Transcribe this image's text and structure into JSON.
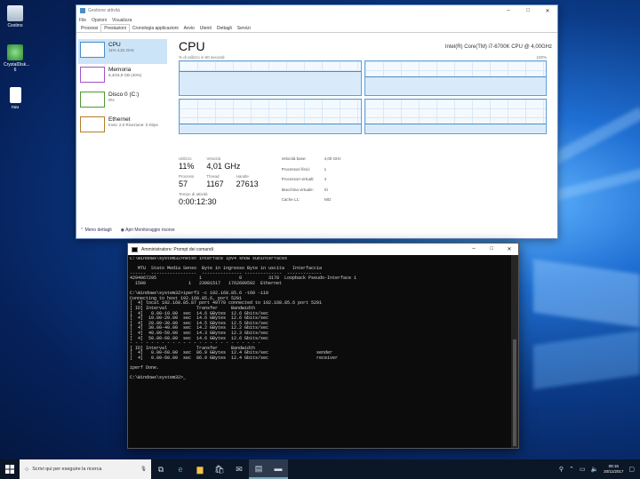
{
  "desktop": {
    "icons": [
      {
        "label": "Cestino"
      },
      {
        "label": "CrystalDisk...\n6"
      },
      {
        "label": "nuu"
      }
    ]
  },
  "taskmgr": {
    "title": "Gestione attività",
    "menu": [
      "File",
      "Opzioni",
      "Visualizza"
    ],
    "tabs": [
      "Processi",
      "Prestazioni",
      "Cronologia applicazioni",
      "Avvio",
      "Utenti",
      "Dettagli",
      "Servizi"
    ],
    "active_tab": 1,
    "resources": [
      {
        "name": "CPU",
        "sub": "11%  4,01 GHz",
        "color": "#4a8cc8"
      },
      {
        "name": "Memoria",
        "sub": "6,4/15,9 GB (40%)",
        "color": "#a453c7"
      },
      {
        "name": "Disco 0 (C:)",
        "sub": "0%",
        "color": "#4d9a2e"
      },
      {
        "name": "Ethernet",
        "sub": "Invio: 2,0  Ricezione: 0 Kbps",
        "color": "#b37c28"
      }
    ],
    "cpu_title": "CPU",
    "cpu_model": "Intel(R) Core(TM) i7-6700K CPU @ 4,00GHz",
    "graph_label_left": "% di utilizzo in 60 secondi",
    "graph_label_right": "100%",
    "graph_levels": [
      0.72,
      0.55,
      0.3,
      0.28
    ],
    "stats": {
      "utilizzo_label": "Utilizzo",
      "utilizzo": "11%",
      "velocita_label": "Velocità",
      "velocita": "4,01 GHz",
      "processi_label": "Processi",
      "processi": "57",
      "thread_label": "Thread",
      "thread": "1167",
      "handle_label": "Handle",
      "handle": "27613",
      "uptime_label": "Tempo di attività",
      "uptime": "0:00:12:30"
    },
    "details": [
      {
        "k": "Velocità base:",
        "v": "4,00 GHz"
      },
      {
        "k": "Processori fisici:",
        "v": "1"
      },
      {
        "k": "Processori virtuali:",
        "v": "4"
      },
      {
        "k": "Macchina virtuale:",
        "v": "Sì"
      },
      {
        "k": "Cache L1:",
        "v": "N/D"
      }
    ],
    "footer_less": "Meno dettagli",
    "footer_monitor": "Apri Monitoraggio risorse"
  },
  "cmd": {
    "title": "Amministratore: Prompt dei comandi",
    "text": "C:\\Windows\\system32>netsh interface ipv4 show subinterfaces\n\n   MTU  Stato Media Senso  Byte in ingresso Byte in uscita   Interfaccia\n------  -----------------  --------------- --------------  -------------\n4294967295                1              0          3178  Loopback Pseudo-Interface 1\n  1500                1   23981517   1762600592  Ethernet\n\nC:\\Windows\\system32>iperf3 -c 192.168.85.6 -t60 -i10\nConnecting to host 192.168.85.6, port 5201\n[  4] local 192.168.85.87 port 49770 connected to 192.168.85.6 port 5201\n[ ID] Interval           Transfer     Bandwidth\n[  4]   0.00-10.00  sec  14.6 GBytes  12.6 Gbits/sec\n[  4]  10.00-20.00  sec  14.6 GBytes  12.6 Gbits/sec\n[  4]  20.00-30.00  sec  14.5 GBytes  12.5 Gbits/sec\n[  4]  30.00-40.00  sec  14.2 GBytes  12.2 Gbits/sec\n[  4]  40.00-50.00  sec  14.3 GBytes  12.3 Gbits/sec\n[  4]  50.00-60.00  sec  14.6 GBytes  12.6 Gbits/sec\n- - - - - - - - - - - - - - - - - - - - - - - - -\n[ ID] Interval           Transfer     Bandwidth\n[  4]   0.00-60.00  sec  86.9 GBytes  12.4 Gbits/sec                  sender\n[  4]   0.00-60.00  sec  86.9 GBytes  12.4 Gbits/sec                  receiver\n\niperf Done.\n\nC:\\Windows\\system32>_"
  },
  "taskbar": {
    "search_placeholder": "Scrivi qui per eseguire la ricerca",
    "time": "08:16",
    "date": "20/11/2017"
  }
}
